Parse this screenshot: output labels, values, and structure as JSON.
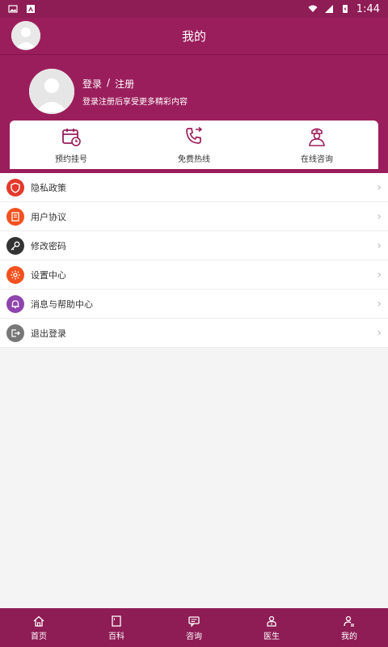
{
  "status_bar": {
    "time": "1:44"
  },
  "appbar": {
    "title": "我的"
  },
  "profile": {
    "login_label": "登录",
    "divider": "/",
    "register_label": "注册",
    "subtitle": "登录注册后享受更多精彩内容"
  },
  "quick_actions": [
    {
      "label": "预约挂号",
      "icon": "calendar-icon"
    },
    {
      "label": "免费热线",
      "icon": "phone-icon"
    },
    {
      "label": "在线咨询",
      "icon": "nurse-icon"
    }
  ],
  "menu": [
    {
      "label": "隐私政策",
      "icon": "shield-icon",
      "color": "#e33a2b"
    },
    {
      "label": "用户协议",
      "icon": "document-icon",
      "color": "#f4511e"
    },
    {
      "label": "修改密码",
      "icon": "key-icon",
      "color": "#333333"
    },
    {
      "label": "设置中心",
      "icon": "gear-icon",
      "color": "#f4511e"
    },
    {
      "label": "消息与帮助中心",
      "icon": "bell-icon",
      "color": "#8e44ad"
    },
    {
      "label": "退出登录",
      "icon": "logout-icon",
      "color": "#777777"
    }
  ],
  "tabs": [
    {
      "label": "首页",
      "icon": "home-icon"
    },
    {
      "label": "百科",
      "icon": "book-icon"
    },
    {
      "label": "咨询",
      "icon": "chat-icon"
    },
    {
      "label": "医生",
      "icon": "doctor-icon"
    },
    {
      "label": "我的",
      "icon": "user-icon"
    }
  ],
  "colors": {
    "brand": "#9b1e5c",
    "bottom_bar": "#8e1c55",
    "chevron": "#bbbbbb"
  }
}
